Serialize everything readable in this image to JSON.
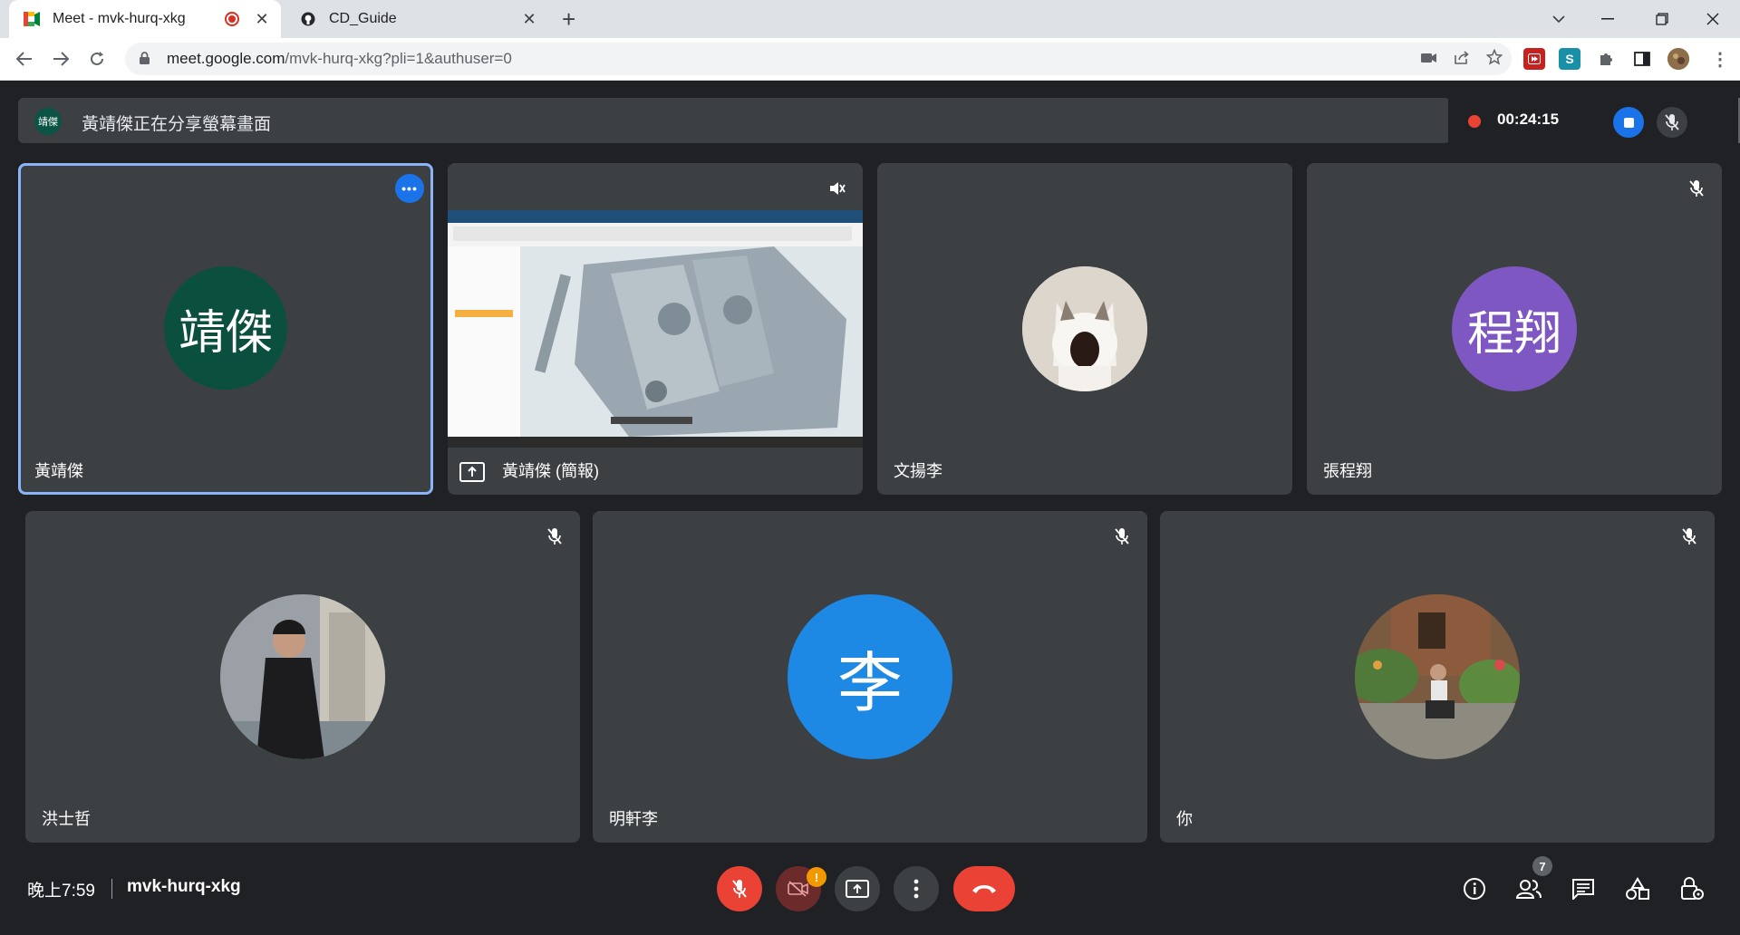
{
  "browser": {
    "tabs": [
      {
        "title": "Meet - mvk-hurq-xkg",
        "active": true
      },
      {
        "title": "CD_Guide",
        "active": false
      }
    ],
    "url_host": "meet.google.com",
    "url_path": "/mvk-hurq-xkg?pli=1&authuser=0"
  },
  "banner": {
    "avatar_text": "靖傑",
    "message": "黃靖傑正在分享螢幕畫面",
    "recording_time": "00:24:15"
  },
  "participants": [
    {
      "name": "黃靖傑",
      "avatar_text": "靖傑",
      "avatar_color": "#0b4f3f",
      "selected": true
    },
    {
      "name": "黃靖傑 (簡報)",
      "presenting": true
    },
    {
      "name": "文揚李",
      "avatar_color": "#e8e4de"
    },
    {
      "name": "張程翔",
      "avatar_text": "程翔",
      "avatar_color": "#7e57c2",
      "muted": true
    },
    {
      "name": "洪士哲",
      "muted": true
    },
    {
      "name": "明軒李",
      "avatar_text": "李",
      "avatar_color": "#1e88e5",
      "muted": true
    },
    {
      "name": "你",
      "muted": true
    }
  ],
  "bottom": {
    "time": "晚上7:59",
    "meeting_code": "mvk-hurq-xkg",
    "people_count": "7",
    "camera_warning": "!"
  },
  "colors": {
    "background": "#202124",
    "tile": "#3c4043",
    "danger": "#ea4335",
    "accent": "#1a73e8"
  }
}
